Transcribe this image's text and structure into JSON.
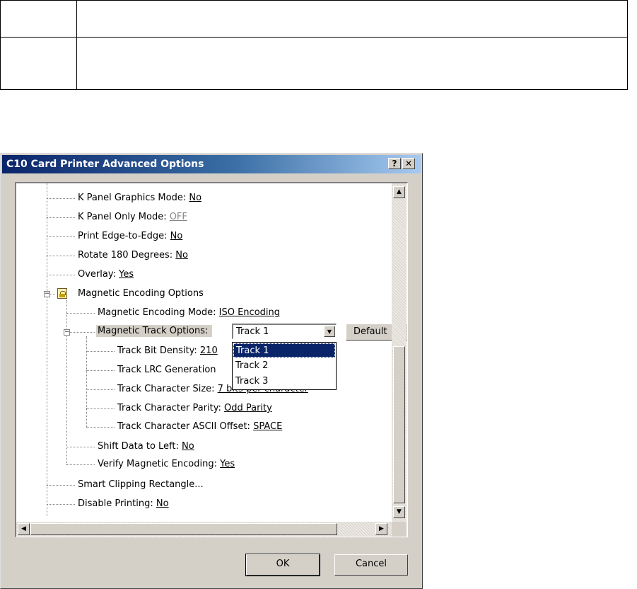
{
  "dialog": {
    "title": "C10 Card Printer Advanced Options",
    "help_label": "?",
    "close_label": "✕",
    "ok_label": "OK",
    "cancel_label": "Cancel"
  },
  "tree": {
    "items": [
      {
        "label": "K Panel Graphics Mode: ",
        "value": "No"
      },
      {
        "label": "K Panel Only Mode: ",
        "value": "OFF"
      },
      {
        "label": "Print Edge-to-Edge: ",
        "value": "No"
      },
      {
        "label": "Rotate 180 Degrees: ",
        "value": "No"
      },
      {
        "label": "Overlay: ",
        "value": "Yes"
      },
      {
        "label": "Magnetic Encoding Options"
      },
      {
        "label": "Magnetic Encoding Mode: ",
        "value": "ISO Encoding"
      },
      {
        "label": "Magnetic Track Options:"
      },
      {
        "label": "Track Bit Density: ",
        "value": "210"
      },
      {
        "label": "Track LRC Generation"
      },
      {
        "label": "Track Character Size: ",
        "value": "7 bits per character"
      },
      {
        "label": "Track Character Parity: ",
        "value": "Odd Parity"
      },
      {
        "label": "Track Character ASCII Offset: ",
        "value": "SPACE"
      },
      {
        "label": "Shift Data to Left: ",
        "value": "No"
      },
      {
        "label": "Verify Magnetic Encoding: ",
        "value": "Yes"
      },
      {
        "label": "Smart Clipping Rectangle..."
      },
      {
        "label": "Disable Printing: ",
        "value": "No"
      }
    ]
  },
  "track_combo": {
    "value": "Track 1",
    "options": [
      "Track 1",
      "Track 2",
      "Track 3"
    ],
    "default_label": "Default"
  },
  "icons": {
    "up": "▲",
    "down": "▼",
    "left": "◀",
    "right": "▶",
    "combo_arrow": "▼",
    "minus": "−"
  }
}
